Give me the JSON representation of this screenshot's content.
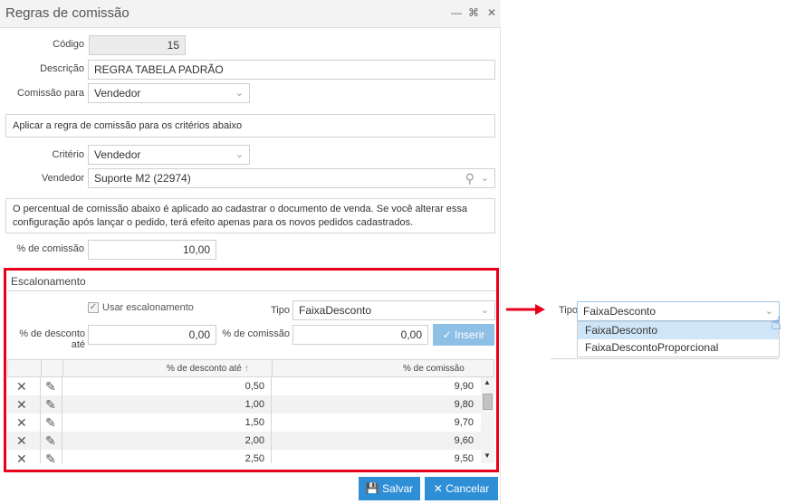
{
  "window": {
    "title": "Regras de comissão",
    "minimize_icon": "minimize-icon",
    "maximize_icon": "maximize-icon",
    "close_icon": "close-icon"
  },
  "form": {
    "codigo_label": "Código",
    "codigo_value": "15",
    "descricao_label": "Descrição",
    "descricao_value": "REGRA TABELA PADRÃO",
    "comissao_para_label": "Comissão para",
    "comissao_para_value": "Vendedor",
    "criteria_panel_text": "Aplicar a regra de comissão para os critérios abaixo",
    "criterio_label": "Critério",
    "criterio_value": "Vendedor",
    "vendedor_label": "Vendedor",
    "vendedor_value": "Suporte M2 (22974)",
    "info_text_line1": "O percentual de comissão abaixo é aplicado ao cadastrar o documento de venda. Se você alterar essa",
    "info_text_line2": "configuração após lançar o pedido, terá efeito apenas para os novos pedidos cadastrados.",
    "pct_comissao_label": "% de comissão",
    "pct_comissao_value": "10,00"
  },
  "escalonamento": {
    "title": "Escalonamento",
    "usar_label": "Usar escalonamento",
    "usar_checked": true,
    "tipo_label": "Tipo",
    "tipo_value": "FaixaDesconto",
    "desconto_ate_label": "% de desconto até",
    "desconto_ate_value": "0,00",
    "comissao_label": "% de comissão",
    "comissao_value": "0,00",
    "inserir_label": "Inserir",
    "grid": {
      "headers": [
        "% de desconto até",
        "% de comissão"
      ],
      "rows": [
        [
          "0,50",
          "9,90"
        ],
        [
          "1,00",
          "9,80"
        ],
        [
          "1,50",
          "9,70"
        ],
        [
          "2,00",
          "9,60"
        ],
        [
          "2,50",
          "9,50"
        ]
      ]
    }
  },
  "footer": {
    "salvar_label": "Salvar",
    "cancelar_label": "Cancelar"
  },
  "zoom_dropdown": {
    "tipo_label": "Tipo",
    "selected": "FaixaDesconto",
    "options": [
      "FaixaDesconto",
      "FaixaDescontoProporcional"
    ]
  },
  "colors": {
    "accent": "#2f8fd6",
    "highlight": "#e8001b",
    "selected_option": "#cfe6f8"
  }
}
